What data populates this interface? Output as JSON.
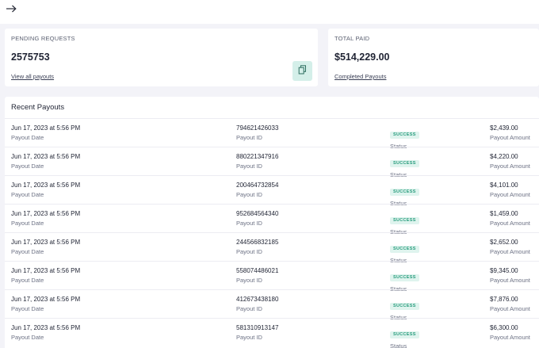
{
  "header": {
    "back_icon": "arrow-right-icon"
  },
  "pending_card": {
    "label": "PENDING REQUESTS",
    "value": "2575753",
    "link": "View all payouts",
    "icon": "document-icon"
  },
  "total_card": {
    "label": "TOTAL PAID",
    "value": "$514,229.00",
    "link": "Completed Payouts"
  },
  "payouts": {
    "title": "Recent Payouts",
    "labels": {
      "date": "Payout Date",
      "id": "Payout ID",
      "status": "Status",
      "amount": "Payout Amount"
    },
    "rows": [
      {
        "date": "Jun 17, 2023 at 5:56 PM",
        "id": "794621426033",
        "status": "SUCCESS",
        "amount": "$2,439.00"
      },
      {
        "date": "Jun 17, 2023 at 5:56 PM",
        "id": "880221347916",
        "status": "SUCCESS",
        "amount": "$4,220.00"
      },
      {
        "date": "Jun 17, 2023 at 5:56 PM",
        "id": "200464732854",
        "status": "SUCCESS",
        "amount": "$4,101.00"
      },
      {
        "date": "Jun 17, 2023 at 5:56 PM",
        "id": "952684564340",
        "status": "SUCCESS",
        "amount": "$1,459.00"
      },
      {
        "date": "Jun 17, 2023 at 5:56 PM",
        "id": "244566832185",
        "status": "SUCCESS",
        "amount": "$2,652.00"
      },
      {
        "date": "Jun 17, 2023 at 5:56 PM",
        "id": "558074486021",
        "status": "SUCCESS",
        "amount": "$9,345.00"
      },
      {
        "date": "Jun 17, 2023 at 5:56 PM",
        "id": "412673438180",
        "status": "SUCCESS",
        "amount": "$7,876.00"
      },
      {
        "date": "Jun 17, 2023 at 5:56 PM",
        "id": "581310913147",
        "status": "SUCCESS",
        "amount": "$6,300.00"
      }
    ]
  },
  "colors": {
    "background": "#f3f3f8",
    "success_text": "#2a9d7e",
    "success_bg": "#dff4ee",
    "icon_button_bg": "#d4efe9"
  }
}
